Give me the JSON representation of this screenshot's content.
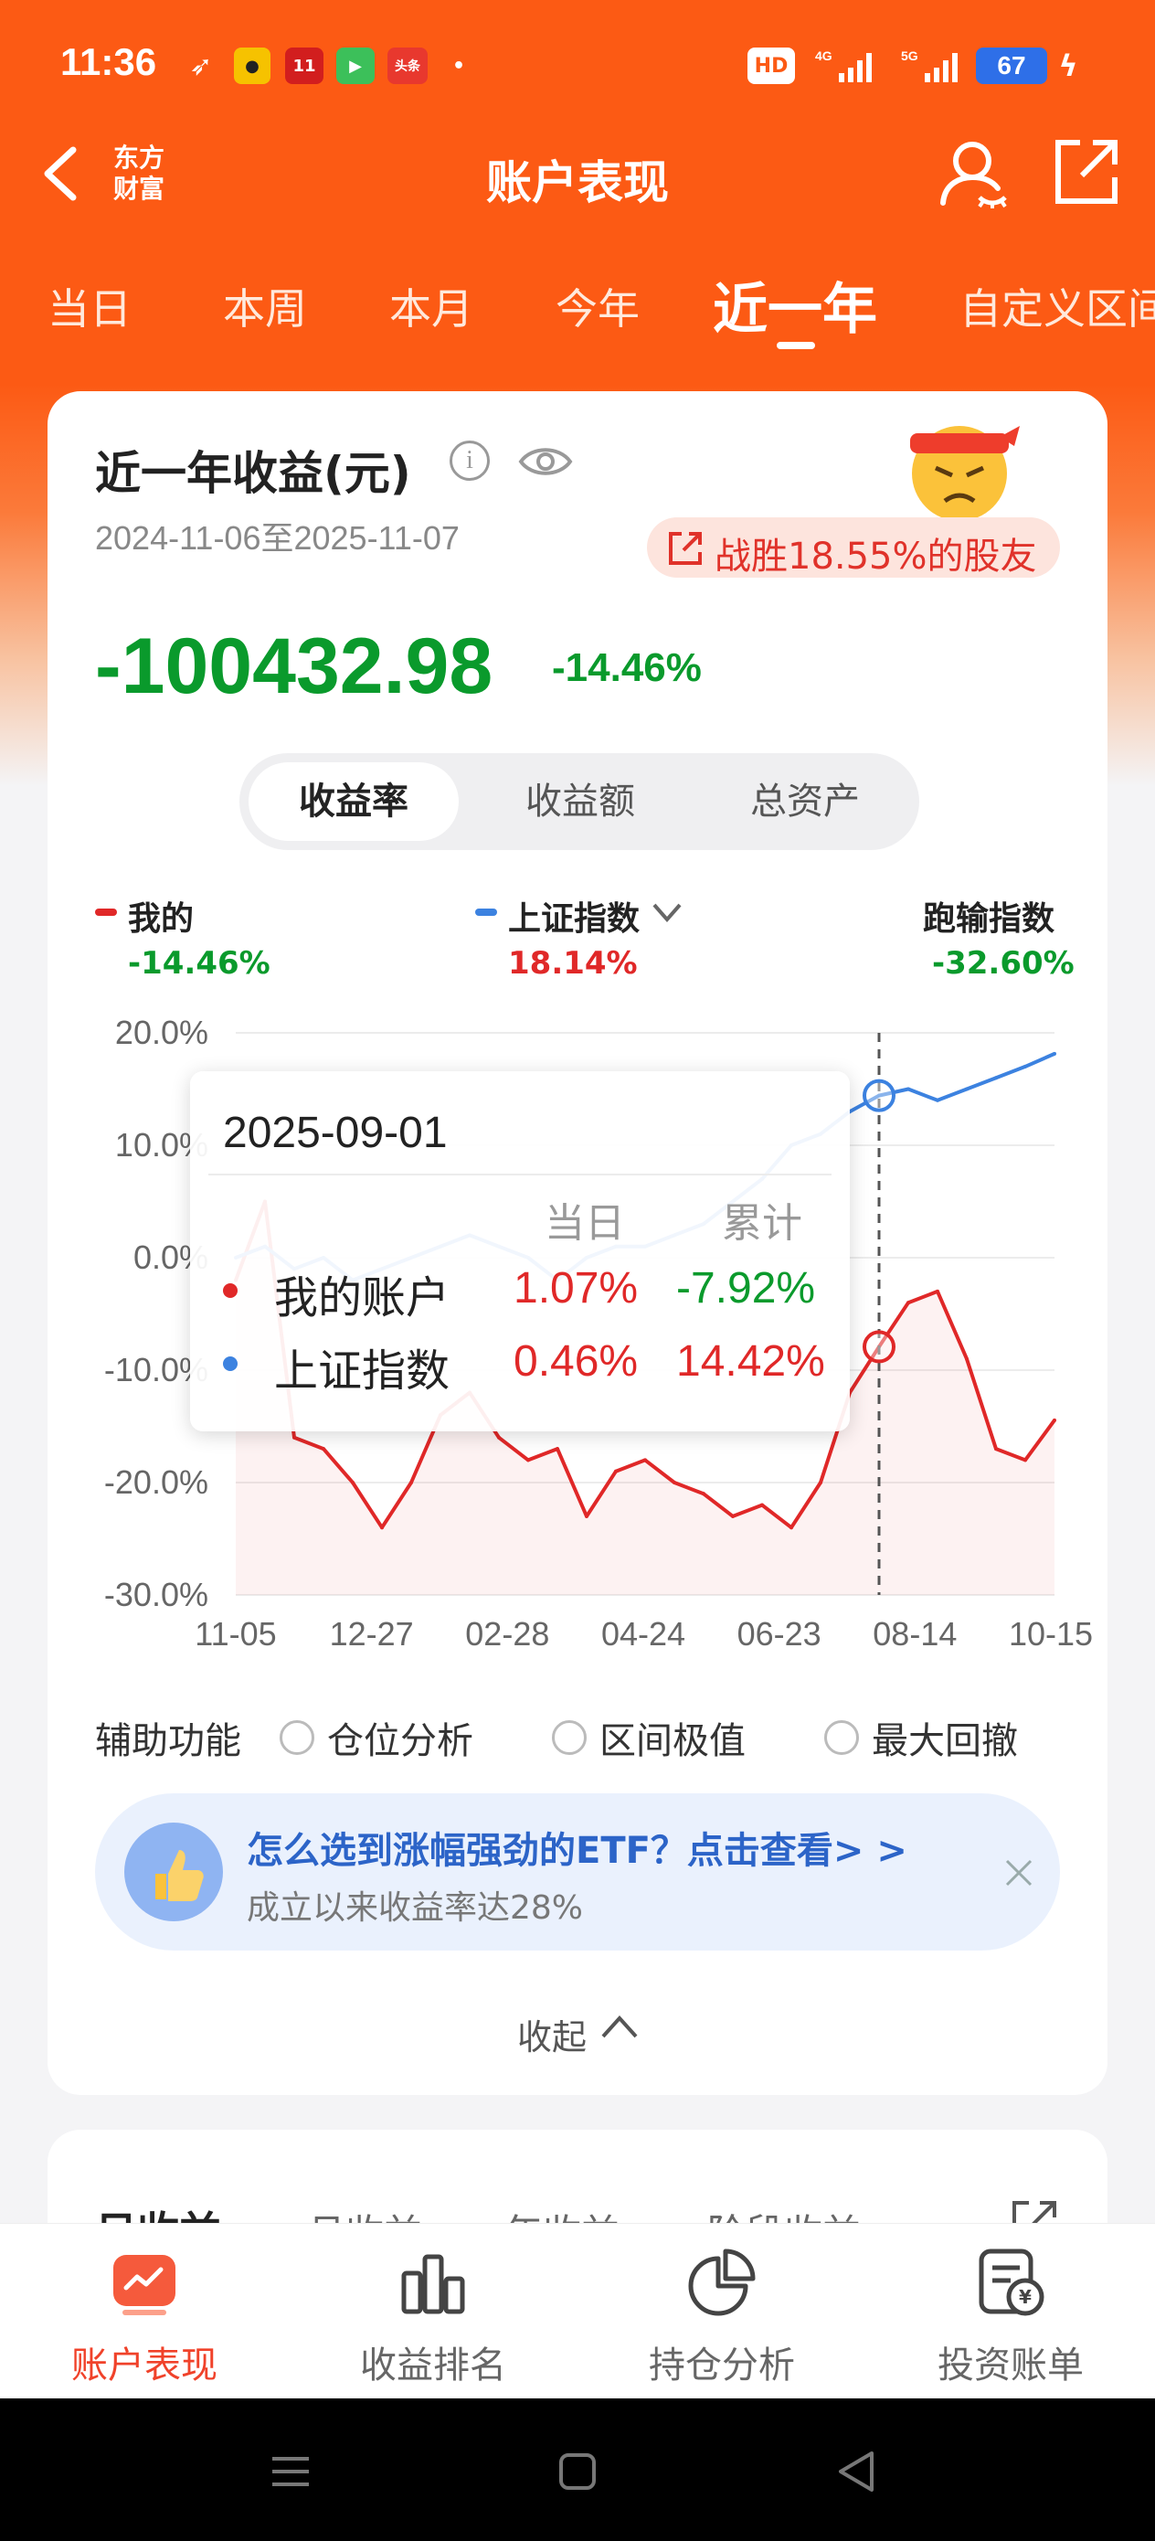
{
  "status_bar": {
    "time": "11:36",
    "battery": "67"
  },
  "header": {
    "title": "账户表现",
    "logo_line1": "东方",
    "logo_line2": "财富"
  },
  "period_tabs": [
    "当日",
    "本周",
    "本月",
    "今年",
    "近一年",
    "自定义区间"
  ],
  "active_tab": "近一年",
  "summary": {
    "title": "近一年收益(元)",
    "date_range": "2024-11-06至2025-11-07",
    "beat_text": "战胜18.55%的股友",
    "amount": "-100432.98",
    "percent": "-14.46%"
  },
  "segments": [
    "收益率",
    "收益额",
    "总资产"
  ],
  "active_segment": "收益率",
  "legend": {
    "mine": {
      "name": "我的",
      "value": "-14.46%",
      "color": "#e02828"
    },
    "index": {
      "name": "上证指数",
      "value": "18.14%",
      "color": "#3c82e0"
    },
    "outrun": {
      "name": "跑输指数",
      "value": "-32.60%"
    }
  },
  "colors": {
    "up": "#e02828",
    "down": "#0a9a2c",
    "brand": "#fc5a14"
  },
  "tooltip": {
    "date": "2025-09-01",
    "col_day": "当日",
    "col_total": "累计",
    "rows": [
      {
        "name": "我的账户",
        "day": "1.07%",
        "total": "-7.92%"
      },
      {
        "name": "上证指数",
        "day": "0.46%",
        "total": "14.42%"
      }
    ]
  },
  "chart_data": {
    "type": "line",
    "y_unit": "%",
    "ylim": [
      -30,
      20
    ],
    "y_ticks": [
      "20.0%",
      "10.0%",
      "0.0%",
      "-10.0%",
      "-20.0%",
      "-30.0%"
    ],
    "x_tick_labels": [
      "11-05",
      "12-27",
      "02-28",
      "04-24",
      "06-23",
      "08-14",
      "10-15"
    ],
    "x": [
      "11-05",
      "11-20",
      "12-05",
      "12-20",
      "12-27",
      "01-10",
      "01-25",
      "02-10",
      "02-28",
      "03-15",
      "03-30",
      "04-10",
      "04-24",
      "05-10",
      "05-25",
      "06-10",
      "06-23",
      "07-10",
      "07-25",
      "08-10",
      "08-14",
      "08-25",
      "09-01",
      "09-10",
      "09-25",
      "10-05",
      "10-15",
      "10-25",
      "11-07"
    ],
    "series": [
      {
        "name": "我的",
        "color": "#e02828",
        "values": [
          -2,
          5,
          -16,
          -17,
          -20,
          -24,
          -20,
          -14,
          -12,
          -16,
          -18,
          -17,
          -23,
          -19,
          -18,
          -20,
          -21,
          -23,
          -22,
          -24,
          -20,
          -12,
          -7.92,
          -4,
          -3,
          -9,
          -17,
          -18,
          -14.46
        ]
      },
      {
        "name": "上证指数",
        "color": "#3c82e0",
        "values": [
          0,
          1,
          -1,
          0,
          -2,
          -1,
          0,
          1,
          2,
          1,
          0,
          -2,
          0,
          1,
          1,
          2,
          3,
          5,
          7,
          10,
          11,
          13,
          14.42,
          15,
          14,
          15,
          16,
          17,
          18.14
        ]
      }
    ],
    "highlight_x": "09-01"
  },
  "aux": {
    "label": "辅助功能",
    "options": [
      "仓位分析",
      "区间极值",
      "最大回撤"
    ]
  },
  "promo": {
    "title": "怎么选到涨幅强劲的ETF？点击查看> >",
    "subtitle": "成立以来收益率达28%"
  },
  "collapse": "收起",
  "sub_tabs": [
    "日收益",
    "月收益",
    "年收益",
    "阶段收益"
  ],
  "bottom_nav": [
    "账户表现",
    "收益排名",
    "持仓分析",
    "投资账单"
  ],
  "bottom_active": "账户表现"
}
